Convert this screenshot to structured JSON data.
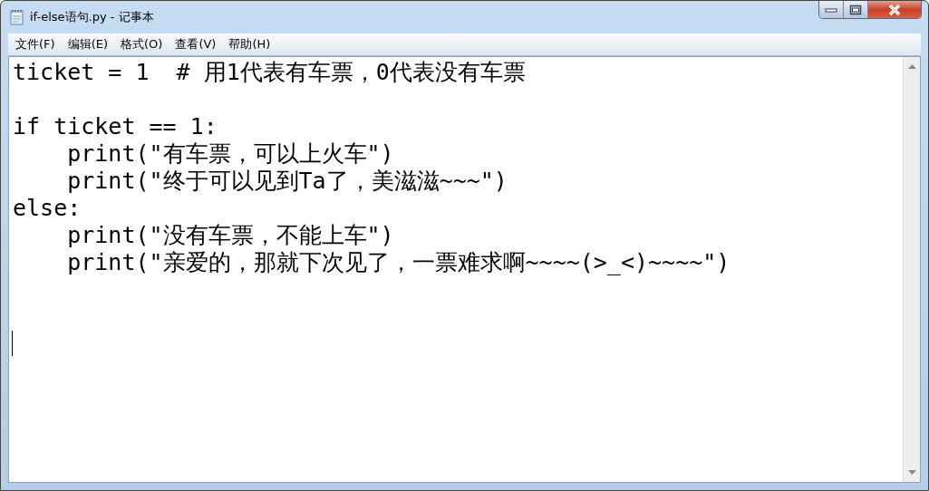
{
  "window": {
    "title": "if-else语句.py - 记事本"
  },
  "menu": [
    "文件(F)",
    "编辑(E)",
    "格式(O)",
    "查看(V)",
    "帮助(H)"
  ],
  "editor": {
    "paragraphs": [
      {
        "lines": [
          "ticket = 1  # 用1代表有车票，0代表没有车票"
        ]
      },
      {
        "lines": [
          "if ticket == 1:",
          "    print(\"有车票，可以上火车\")",
          "    print(\"终于可以见到Ta了，美滋滋~~~\")",
          "else:",
          "    print(\"没有车票，不能上车\")",
          "    print(\"亲爱的，那就下次见了，一票难求啊~~~~(>_<)~~~~\")"
        ]
      }
    ]
  }
}
